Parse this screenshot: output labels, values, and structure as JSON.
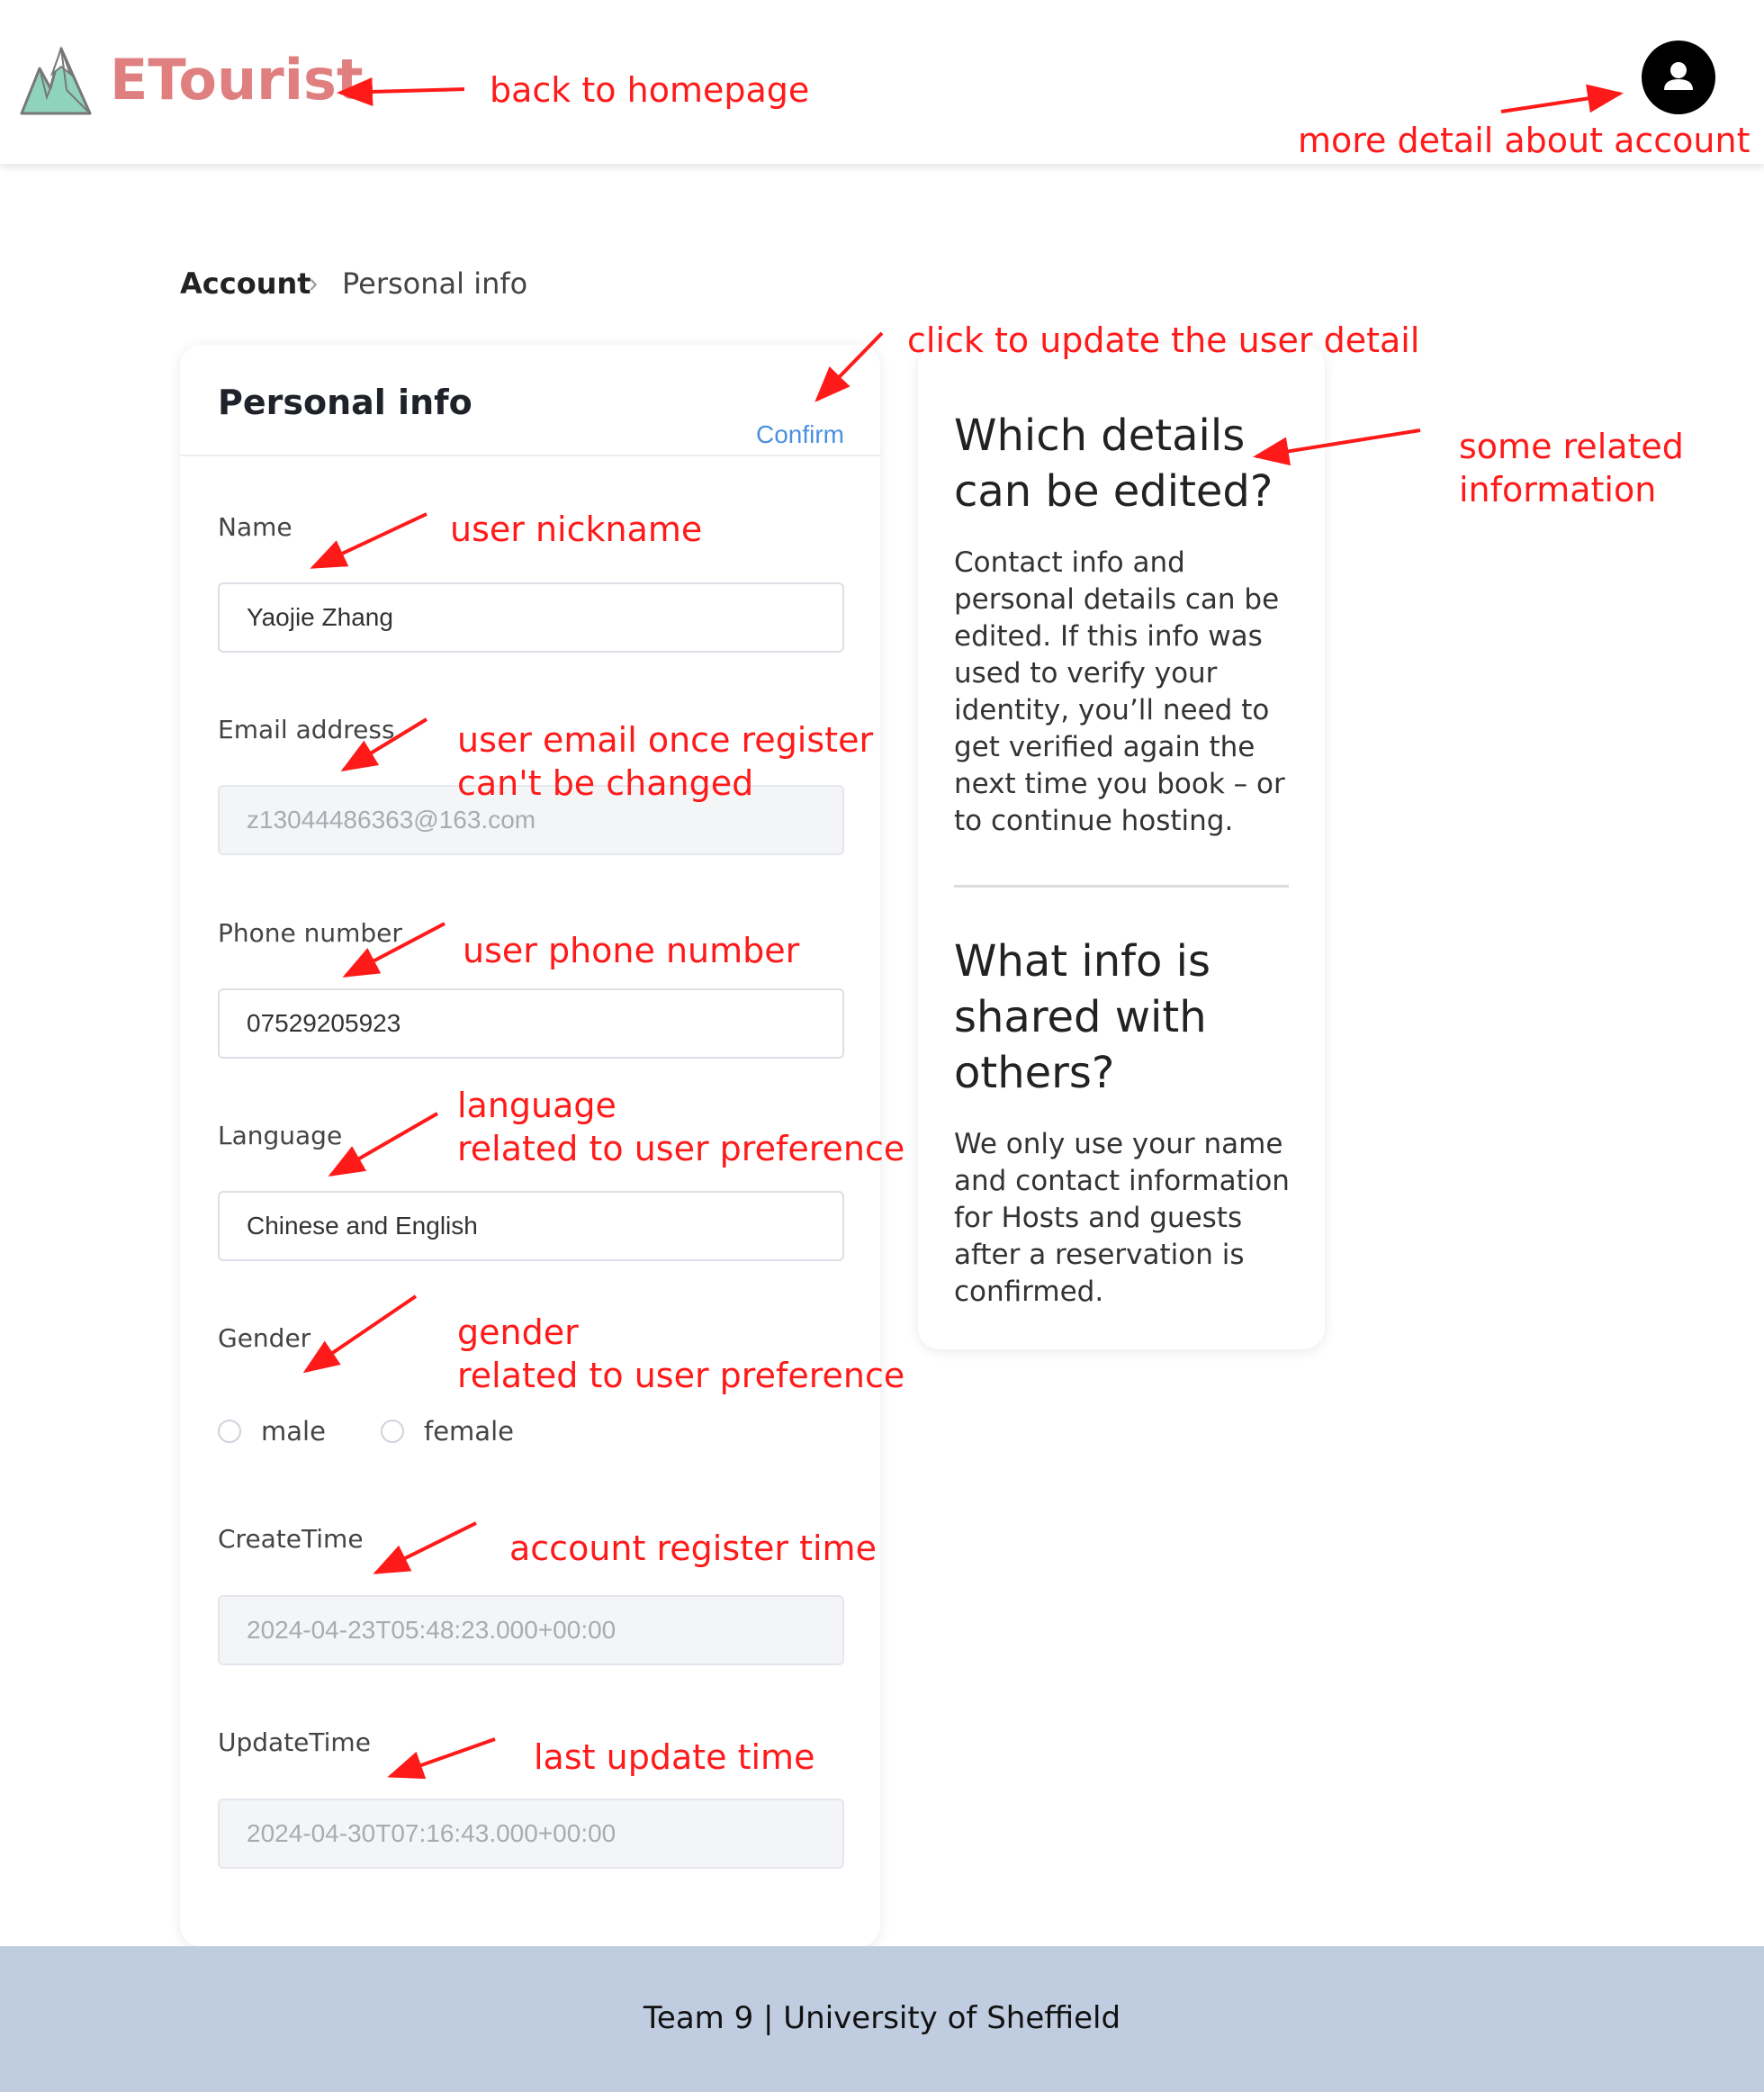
{
  "header": {
    "brand": "ETourist",
    "logo_icon": "mountain-logo-icon",
    "avatar_icon": "user-avatar-icon"
  },
  "breadcrumb": {
    "root": "Account",
    "separator_icon": "chevron-right-icon",
    "current": "Personal info"
  },
  "form": {
    "title": "Personal info",
    "confirm_label": "Confirm",
    "fields": {
      "name": {
        "label": "Name",
        "value": "Yaojie Zhang"
      },
      "email": {
        "label": "Email address",
        "placeholder": "z13044486363@163.com"
      },
      "phone": {
        "label": "Phone number",
        "value": "07529205923"
      },
      "language": {
        "label": "Language",
        "value": "Chinese and English"
      },
      "gender": {
        "label": "Gender",
        "options": [
          "male",
          "female"
        ]
      },
      "create_time": {
        "label": "CreateTime",
        "placeholder": "2024-04-23T05:48:23.000+00:00"
      },
      "update_time": {
        "label": "UpdateTime",
        "placeholder": "2024-04-30T07:16:43.000+00:00"
      }
    }
  },
  "info_panel": {
    "q1_title": "Which details can be edited?",
    "q1_body": "Contact info and personal details can be edited. If this info was used to verify your identity, you’ll need to get verified again the next time you book – or to continue hosting.",
    "q2_title": "What info is shared with others?",
    "q2_body": "We only use your name and contact information for Hosts and guests after a reservation is confirmed."
  },
  "annotations": {
    "back_home": "back to homepage",
    "account_detail": "more detail about account",
    "click_update": "click to update the user detail",
    "related_line1": "some related",
    "related_line2": "information",
    "nickname": "user nickname",
    "email_line1": "user email once register",
    "email_line2": "can't be changed",
    "phone": "user phone number",
    "lang_line1": "language",
    "lang_line2": "related to user preference",
    "gender_line1": "gender",
    "gender_line2": "related to user preference",
    "register_time": "account register time",
    "update_time": "last update time"
  },
  "footer": {
    "text": "Team 9 | University of Sheffield"
  },
  "colors": {
    "brand": "#e07f7f",
    "annotation": "#ff1a1a",
    "link": "#4a90e2",
    "footer_bg": "#c0cde0"
  }
}
